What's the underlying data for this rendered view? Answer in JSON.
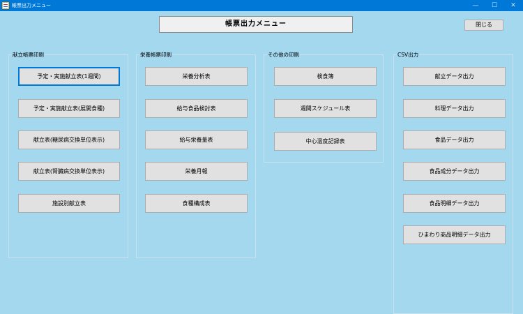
{
  "window": {
    "title": "帳票出力メニュー",
    "minimize_glyph": "—",
    "maximize_glyph": "☐",
    "close_glyph": "✕"
  },
  "heading": "帳票出力メニュー",
  "close_button": "閉じる",
  "groups": {
    "menu_report": {
      "label": "献立帳票印刷",
      "buttons": [
        "予定・実施献立表(1週間)",
        "予定・実施献立表(展開食種)",
        "献立表(糖尿病交換単位表示)",
        "献立表(腎臓病交換単位表示)",
        "施設別献立表"
      ]
    },
    "nutrition_report": {
      "label": "栄養帳票印刷",
      "buttons": [
        "栄養分析表",
        "給与食品検討表",
        "給与栄養量表",
        "栄養月報",
        "食種構成表"
      ]
    },
    "other_print": {
      "label": "その他の印刷",
      "buttons": [
        "検食簿",
        "週間スケジュール表",
        "中心温度記録表"
      ]
    },
    "csv_output": {
      "label": "CSV出力",
      "buttons": [
        "献立データ出力",
        "料理データ出力",
        "食品データ出力",
        "食品成分データ出力",
        "食品明細データ出力",
        "ひまわり商品明細データ出力"
      ]
    }
  }
}
